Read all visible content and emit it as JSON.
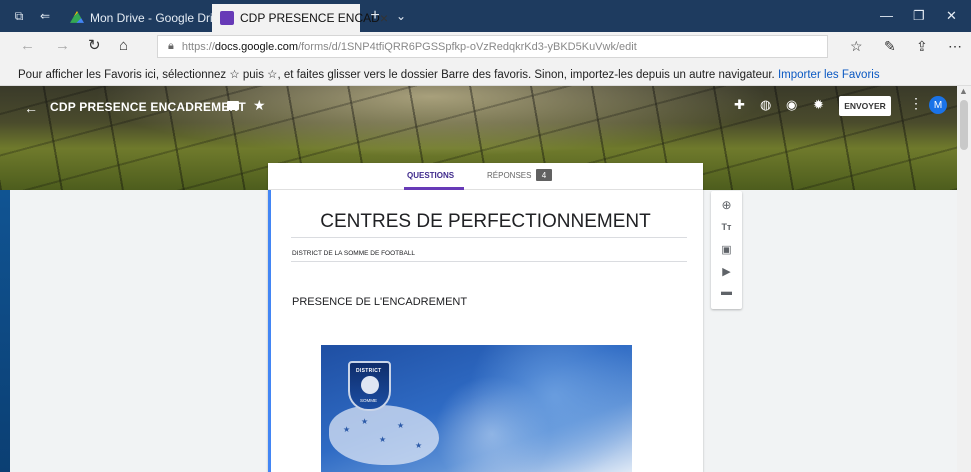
{
  "browser": {
    "tabs": [
      {
        "label": "Mon Drive - Google Drive"
      },
      {
        "label": "CDP PRESENCE ENCAD",
        "close_glyph": "×"
      }
    ],
    "new_tab_glyph": "+",
    "tab_dropdown_glyph": "⌄",
    "address": {
      "url_prefix": "https://",
      "url_domain": "docs.google.com",
      "url_path": "/forms/d/1SNP4tfiQRR6PGSSpfkp-oVzRedqkrKd3-yBKD5KuVwk/edit"
    },
    "favorites_bar": {
      "message": "Pour afficher les Favoris ici, sélectionnez ☆ puis ☆, et faites glisser vers le dossier Barre des favoris. Sinon, importez-les depuis un autre navigateur.",
      "link": "Importer les Favoris"
    }
  },
  "form_header": {
    "title": "CDP PRESENCE ENCADREMENT",
    "send_label": "ENVOYER",
    "avatar_letter": "M"
  },
  "form": {
    "tabs": {
      "questions": "QUESTIONS",
      "responses": "RÉPONSES",
      "responses_count": "4"
    },
    "heading": "CENTRES DE PERFECTIONNEMENT",
    "description": "DISTRICT DE LA SOMME DE FOOTBALL",
    "section_title": "PRESENCE DE L'ENCADREMENT",
    "image": {
      "crest_top": "DISTRICT",
      "crest_bottom": "SOMME",
      "crest_footer": "F F F"
    }
  },
  "colors": {
    "accent": "#673ab7",
    "link": "#0a58c2",
    "avatar": "#1a73e8"
  }
}
